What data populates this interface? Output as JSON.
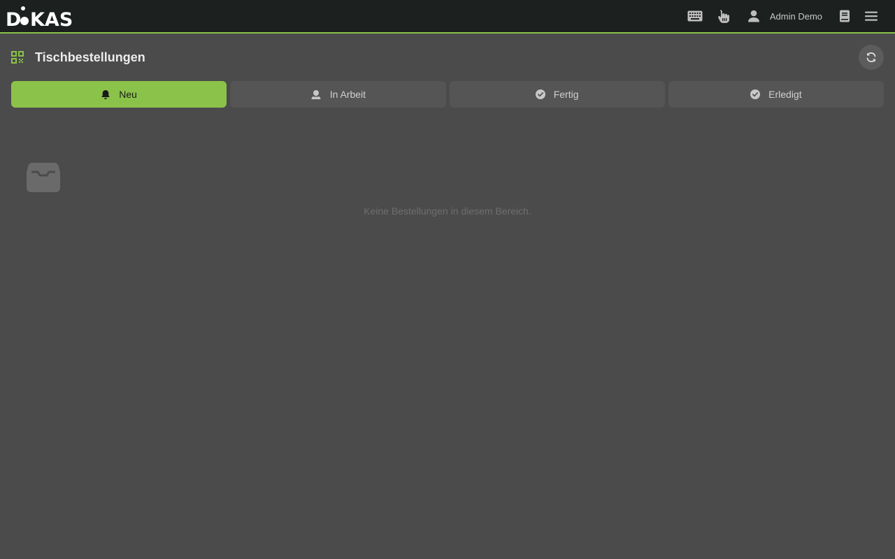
{
  "app": {
    "logo_text": "DiKAS",
    "accent_color": "#8bc34a"
  },
  "topbar": {
    "icons": [
      "keyboard-icon",
      "hand-pointer-icon",
      "user-icon",
      "book-icon",
      "menu-icon"
    ],
    "user_name": "Admin Demo"
  },
  "page": {
    "title": "Tischbestellungen",
    "title_icon": "qr-code-icon",
    "refresh_icon": "refresh-icon"
  },
  "tabs": [
    {
      "label": "Neu",
      "icon": "bell-icon",
      "active": true
    },
    {
      "label": "In Arbeit",
      "icon": "chef-icon",
      "active": false
    },
    {
      "label": "Fertig",
      "icon": "check-circle-icon",
      "active": false
    },
    {
      "label": "Erledigt",
      "icon": "check-circle-icon",
      "active": false
    }
  ],
  "empty_state": {
    "icon": "inbox-icon",
    "message": "Keine Bestellungen in diesem Bereich."
  }
}
